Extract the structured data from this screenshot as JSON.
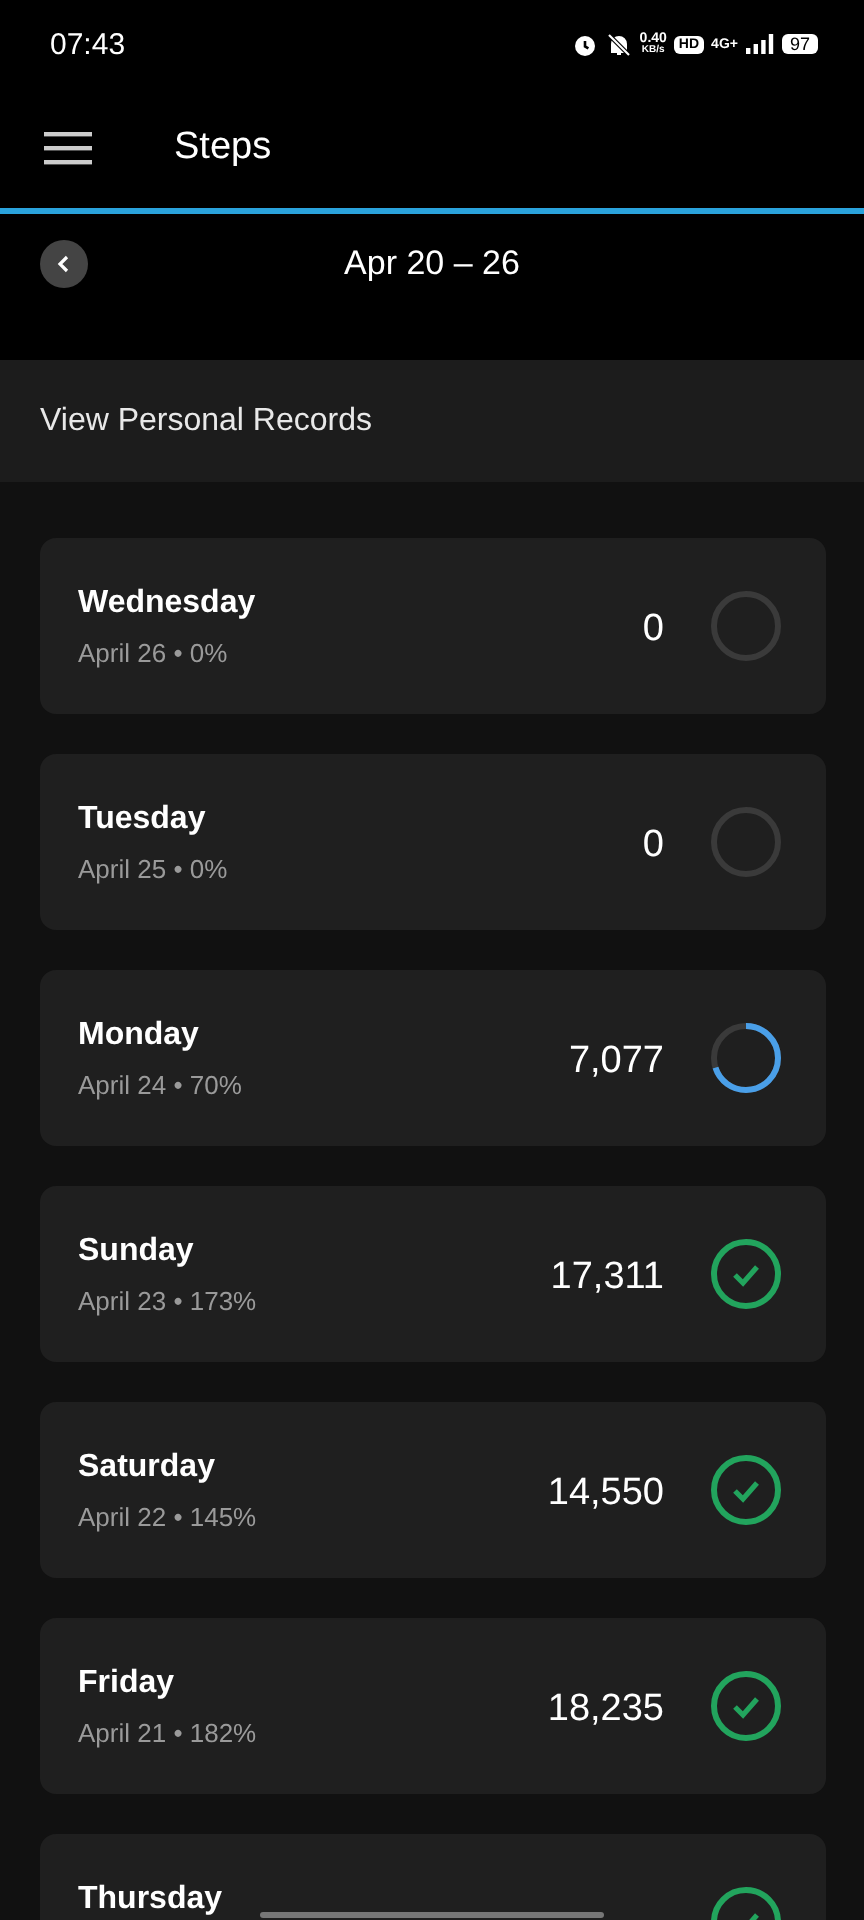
{
  "status_bar": {
    "time": "07:43",
    "net_speed": "0.40",
    "net_unit": "KB/s",
    "hd": "HD",
    "network": "4G+",
    "battery": "97"
  },
  "header": {
    "title": "Steps"
  },
  "week_nav": {
    "range": "Apr 20 – 26"
  },
  "records_link": "View Personal Records",
  "days": [
    {
      "day": "Wednesday",
      "detail": "April 26 • 0%",
      "steps": "0",
      "kind": "empty"
    },
    {
      "day": "Tuesday",
      "detail": "April 25 • 0%",
      "steps": "0",
      "kind": "empty"
    },
    {
      "day": "Monday",
      "detail": "April 24 • 70%",
      "steps": "7,077",
      "kind": "partial"
    },
    {
      "day": "Sunday",
      "detail": "April 23 • 173%",
      "steps": "17,311",
      "kind": "complete"
    },
    {
      "day": "Saturday",
      "detail": "April 22 • 145%",
      "steps": "14,550",
      "kind": "complete"
    },
    {
      "day": "Friday",
      "detail": "April 21 • 182%",
      "steps": "18,235",
      "kind": "complete"
    },
    {
      "day": "Thursday",
      "kind": "complete"
    }
  ]
}
